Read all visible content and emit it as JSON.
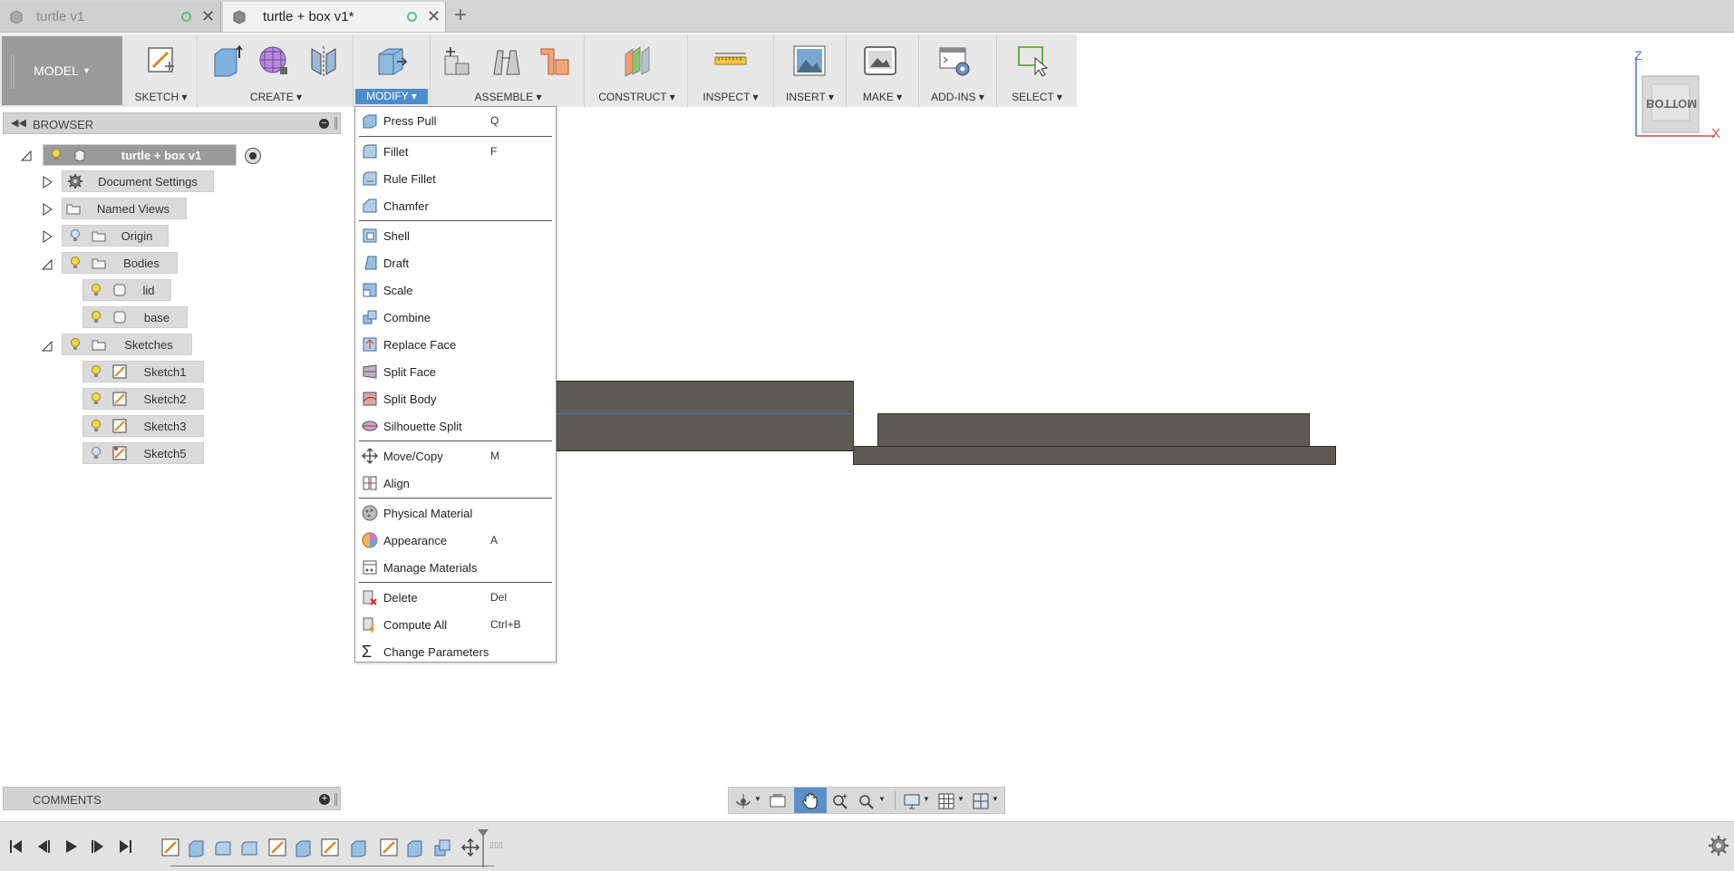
{
  "tabs": [
    {
      "title": "turtle v1",
      "active": false
    },
    {
      "title": "turtle + box v1*",
      "active": true
    }
  ],
  "toolbar": {
    "model_label": "MODEL",
    "groups": [
      {
        "label": "SKETCH",
        "icons": [
          "create-sketch-icon"
        ]
      },
      {
        "label": "CREATE",
        "icons": [
          "extrude-icon",
          "form-icon",
          "mirror-icon"
        ]
      },
      {
        "label": "MODIFY",
        "icons": [
          "press-pull-icon"
        ],
        "active": true
      },
      {
        "label": "ASSEMBLE",
        "icons": [
          "new-component-icon",
          "joint-icon",
          "as-built-joint-icon"
        ]
      },
      {
        "label": "CONSTRUCT",
        "icons": [
          "offset-plane-icon"
        ]
      },
      {
        "label": "INSPECT",
        "icons": [
          "measure-icon"
        ]
      },
      {
        "label": "INSERT",
        "icons": [
          "insert-image-icon"
        ]
      },
      {
        "label": "MAKE",
        "icons": [
          "3d-print-icon"
        ]
      },
      {
        "label": "ADD-INS",
        "icons": [
          "scripts-icon"
        ]
      },
      {
        "label": "SELECT",
        "icons": [
          "select-icon"
        ]
      }
    ]
  },
  "browser": {
    "title": "BROWSER",
    "root": "turtle + box v1",
    "nodes": [
      {
        "label": "Document Settings",
        "icon": "gear-icon"
      },
      {
        "label": "Named Views",
        "icon": "folder-icon"
      },
      {
        "label": "Origin",
        "icon": "folder-icon"
      },
      {
        "label": "Bodies",
        "icon": "folder-icon"
      },
      {
        "label": "lid",
        "icon": "body-icon"
      },
      {
        "label": "base",
        "icon": "body-icon"
      },
      {
        "label": "Sketches",
        "icon": "folder-icon"
      },
      {
        "label": "Sketch1",
        "icon": "sketch-icon"
      },
      {
        "label": "Sketch2",
        "icon": "sketch-icon"
      },
      {
        "label": "Sketch3",
        "icon": "sketch-icon"
      },
      {
        "label": "Sketch5",
        "icon": "sketch-icon"
      }
    ]
  },
  "modify_menu": {
    "items": [
      {
        "label": "Press Pull",
        "shortcut": "Q",
        "icon": "press-pull-icon"
      },
      {
        "label": "Fillet",
        "shortcut": "F",
        "icon": "fillet-icon"
      },
      {
        "label": "Rule Fillet",
        "shortcut": "",
        "icon": "rule-fillet-icon"
      },
      {
        "label": "Chamfer",
        "shortcut": "",
        "icon": "chamfer-icon"
      },
      {
        "label": "Shell",
        "shortcut": "",
        "icon": "shell-icon"
      },
      {
        "label": "Draft",
        "shortcut": "",
        "icon": "draft-icon"
      },
      {
        "label": "Scale",
        "shortcut": "",
        "icon": "scale-icon"
      },
      {
        "label": "Combine",
        "shortcut": "",
        "icon": "combine-icon"
      },
      {
        "label": "Replace Face",
        "shortcut": "",
        "icon": "replace-face-icon"
      },
      {
        "label": "Split Face",
        "shortcut": "",
        "icon": "split-face-icon"
      },
      {
        "label": "Split Body",
        "shortcut": "",
        "icon": "split-body-icon"
      },
      {
        "label": "Silhouette Split",
        "shortcut": "",
        "icon": "silhouette-split-icon"
      },
      {
        "label": "Move/Copy",
        "shortcut": "M",
        "icon": "move-icon"
      },
      {
        "label": "Align",
        "shortcut": "",
        "icon": "align-icon"
      },
      {
        "label": "Physical Material",
        "shortcut": "",
        "icon": "physical-material-icon"
      },
      {
        "label": "Appearance",
        "shortcut": "A",
        "icon": "appearance-icon"
      },
      {
        "label": "Manage Materials",
        "shortcut": "",
        "icon": "manage-materials-icon"
      },
      {
        "label": "Delete",
        "shortcut": "Del",
        "icon": "delete-icon"
      },
      {
        "label": "Compute All",
        "shortcut": "Ctrl+B",
        "icon": "compute-all-icon"
      },
      {
        "label": "Change Parameters",
        "shortcut": "",
        "icon": "sigma-icon"
      }
    ]
  },
  "viewcube": {
    "face": "BOTTOM",
    "axis_x": "X",
    "axis_z": "Z"
  },
  "comments": {
    "title": "COMMENTS"
  },
  "colors": {
    "accent": "#4e8ccc",
    "body": "#5d5b54",
    "toolbar": "#e7e7e7"
  }
}
